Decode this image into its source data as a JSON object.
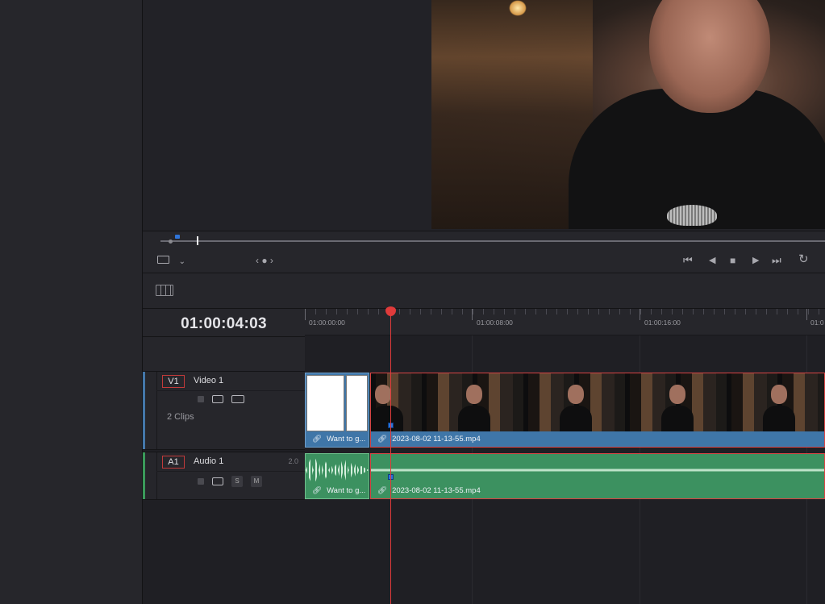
{
  "viewer": {
    "playback": {
      "prev_label": "‹ ● ›"
    }
  },
  "transport": {
    "icons": [
      "jump-start-icon",
      "play-reverse-icon",
      "stop-icon",
      "play-icon",
      "jump-end-icon",
      "loop-icon"
    ]
  },
  "timeline": {
    "timecode": "01:00:04:03",
    "ruler": [
      "01:00:00:00",
      "01:00:08:00",
      "01:00:16:00",
      "01:0"
    ],
    "tracks": [
      {
        "badge": "V1",
        "name": "Video 1",
        "clips_count": "2 Clips",
        "color": "#4477aa"
      },
      {
        "badge": "A1",
        "name": "Audio 1",
        "channels": "2.0",
        "solo": "S",
        "mute": "M",
        "color": "#3a9a5a"
      }
    ],
    "clips": {
      "video_short": "Want to g...",
      "video_main": "2023-08-02 11-13-55.mp4",
      "audio_short": "Want to g...",
      "audio_main": "2023-08-02 11-13-55.mp4"
    }
  },
  "colors": {
    "accent": "#e03b3b",
    "video_clip": "#3f76a8",
    "audio_clip": "#3c9160",
    "marker": "#2f74d8"
  }
}
